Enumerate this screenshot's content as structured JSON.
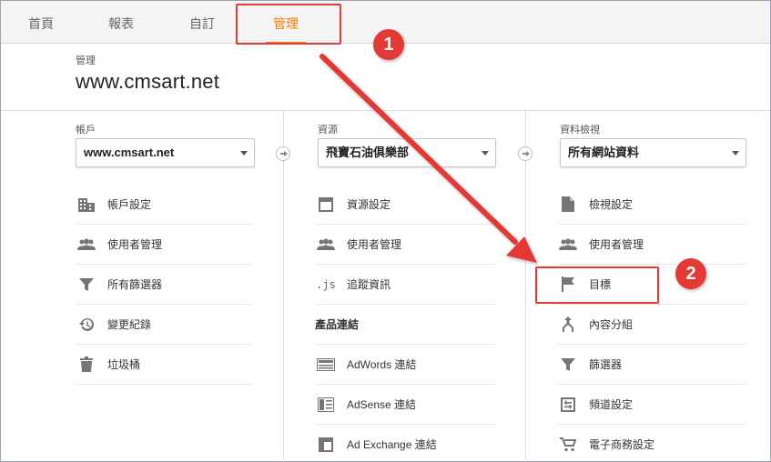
{
  "tabs": [
    {
      "label": "首頁",
      "active": false
    },
    {
      "label": "報表",
      "active": false
    },
    {
      "label": "自訂",
      "active": false
    },
    {
      "label": "管理",
      "active": true
    }
  ],
  "header": {
    "section_label": "管理",
    "site_title": "www.cmsart.net"
  },
  "account": {
    "label": "帳戶",
    "selected": "www.cmsart.net",
    "items": [
      {
        "label": "帳戶設定",
        "icon": "building-icon"
      },
      {
        "label": "使用者管理",
        "icon": "users-icon"
      },
      {
        "label": "所有篩選器",
        "icon": "filter-icon"
      },
      {
        "label": "變更紀錄",
        "icon": "history-icon"
      },
      {
        "label": "垃圾桶",
        "icon": "trash-icon"
      }
    ]
  },
  "property": {
    "label": "資源",
    "selected": "飛寶石油俱樂部",
    "items": [
      {
        "label": "資源設定",
        "icon": "window-icon"
      },
      {
        "label": "使用者管理",
        "icon": "users-icon"
      },
      {
        "label": "追蹤資訊",
        "icon": "js-icon",
        "glyph": ".js"
      }
    ],
    "section_title": "產品連結",
    "links": [
      {
        "label": "AdWords 連結",
        "icon": "adwords-icon"
      },
      {
        "label": "AdSense 連結",
        "icon": "adsense-icon"
      },
      {
        "label": "Ad Exchange 連結",
        "icon": "adexchange-icon"
      }
    ]
  },
  "view": {
    "label": "資料檢視",
    "selected": "所有網站資料",
    "items": [
      {
        "label": "檢視設定",
        "icon": "document-icon"
      },
      {
        "label": "使用者管理",
        "icon": "users-icon"
      },
      {
        "label": "目標",
        "icon": "flag-icon"
      },
      {
        "label": "內容分組",
        "icon": "content-grouping-icon"
      },
      {
        "label": "篩選器",
        "icon": "filter-icon"
      },
      {
        "label": "頻道設定",
        "icon": "channel-settings-icon"
      },
      {
        "label": "電子商務設定",
        "icon": "cart-icon"
      }
    ]
  },
  "annotations": {
    "step1": "1",
    "step2": "2",
    "color": "#e53935"
  }
}
